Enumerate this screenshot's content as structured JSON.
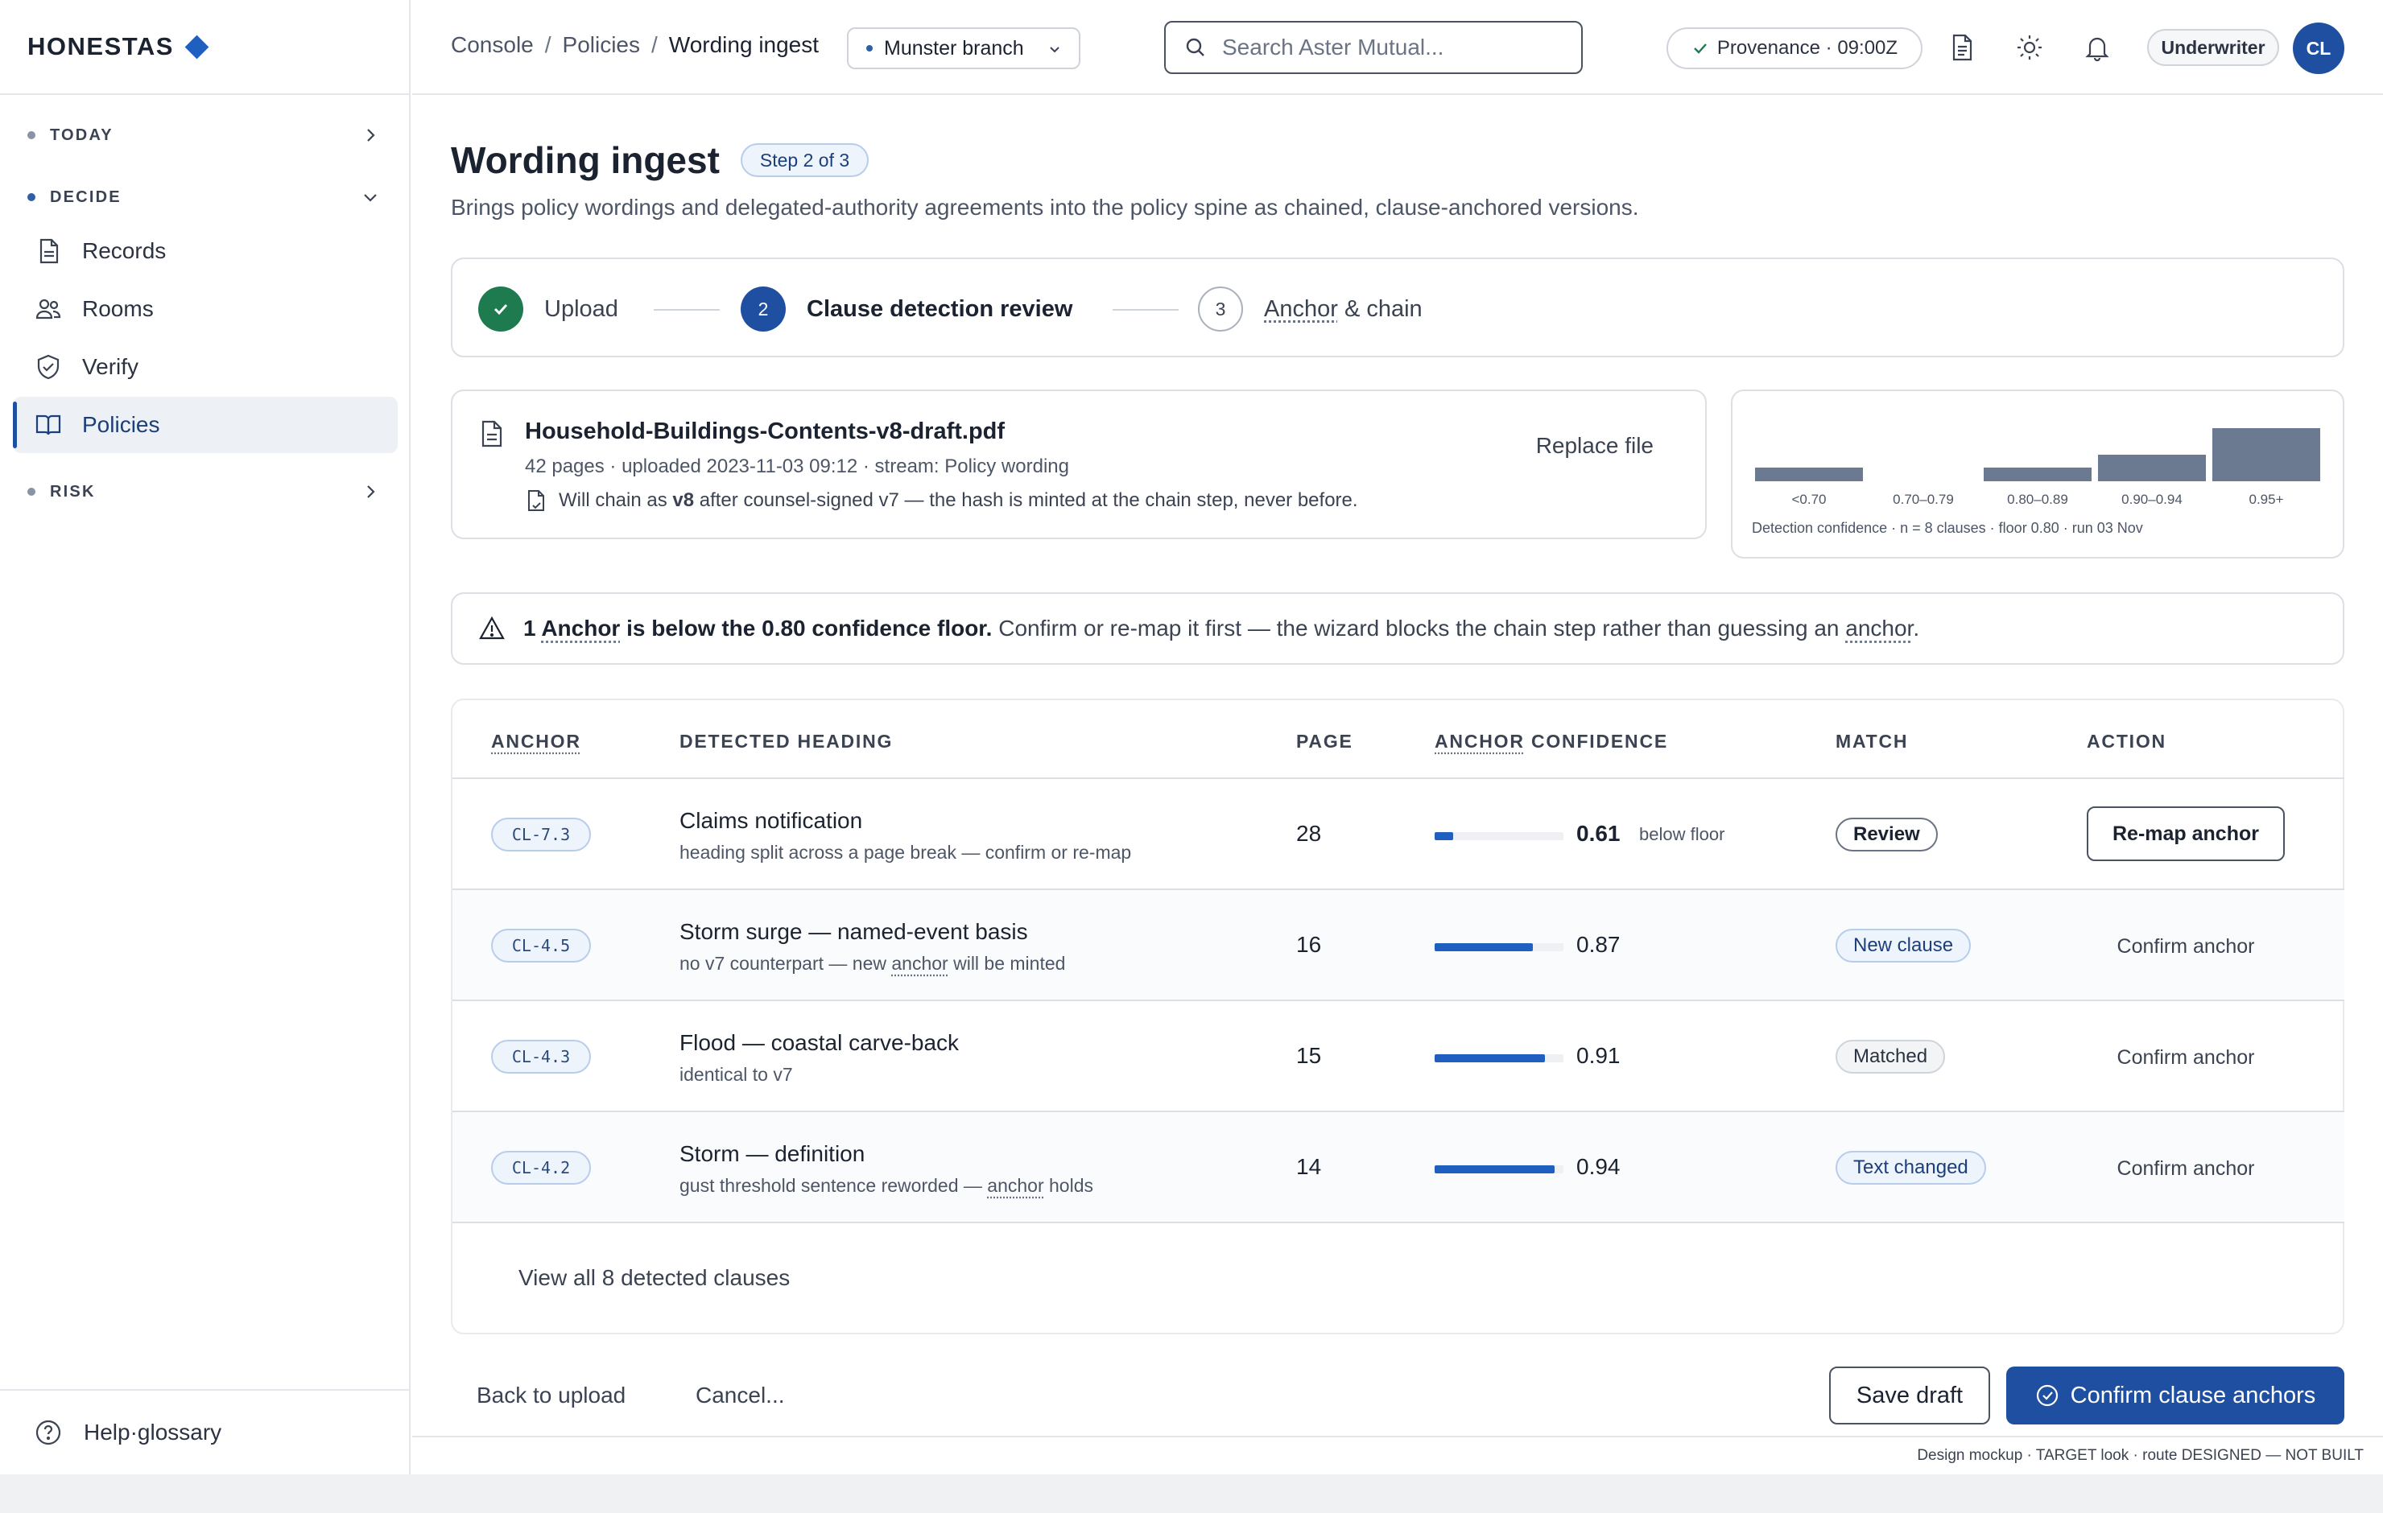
{
  "sidebar": {
    "brand": "HONESTAS",
    "groups": {
      "today": "TODAY",
      "decide": "DECIDE",
      "risk": "RISK"
    },
    "items": [
      {
        "label": "Records",
        "icon": "document-icon"
      },
      {
        "label": "Rooms",
        "icon": "people-icon"
      },
      {
        "label": "Verify",
        "icon": "shield-check-icon"
      },
      {
        "label": "Policies",
        "icon": "book-icon",
        "active": true
      }
    ],
    "help": "Help·glossary"
  },
  "topbar": {
    "breadcrumb": [
      "Console",
      "Policies",
      "Wording ingest"
    ],
    "separator": "/",
    "branch": "Munster branch",
    "search_placeholder": "Search Aster Mutual...",
    "provenance": "Provenance · 09:00Z",
    "role": "Underwriter",
    "avatar": "CL"
  },
  "page": {
    "title": "Wording ingest",
    "step_badge": "Step 2 of 3",
    "subtitle": "Brings policy wordings and delegated-authority agreements into the policy spine as chained, clause-anchored versions."
  },
  "stepper": {
    "steps": [
      {
        "label": "Upload",
        "state": "done"
      },
      {
        "number": "2",
        "label": "Clause detection review",
        "state": "active"
      },
      {
        "number": "3",
        "label_part1": "Anchor",
        "label_part2": " & chain",
        "state": "todo"
      }
    ]
  },
  "file": {
    "name": "Household-Buildings-Contents-v8-draft.pdf",
    "meta": "42 pages · uploaded 2023-11-03 09:12 · stream: Policy wording",
    "chain_pre": "Will chain as ",
    "chain_version": "v8",
    "chain_post": " after counsel-signed v7 — the hash is minted at the chain step, never before.",
    "replace": "Replace file"
  },
  "chart_data": {
    "type": "bar",
    "categories": [
      "<0.70",
      "0.70–0.79",
      "0.80–0.89",
      "0.90–0.94",
      "0.95+"
    ],
    "values": [
      1,
      0,
      1,
      2,
      4
    ],
    "caption": "Detection confidence · n = 8 clauses · floor 0.80 · run 03 Nov",
    "bar_color": "#6c7a91"
  },
  "alert": {
    "count": "1",
    "anchor_word": "Anchor",
    "bold_rest": " is below the 0.80 confidence floor.",
    "text": " Confirm or re-map it first — the wizard blocks the chain step rather than guessing an ",
    "anchor_word2": "anchor",
    "end": "."
  },
  "table": {
    "headers": {
      "anchor": "ANCHOR",
      "heading": "DETECTED HEADING",
      "page": "PAGE",
      "conf_anchor": "ANCHOR",
      "conf_rest": " CONFIDENCE",
      "match": "MATCH",
      "action": "ACTION"
    },
    "rows": [
      {
        "anchor": "CL-7.3",
        "heading": "Claims notification",
        "sub_pre": "heading split across a page break — confirm or re-map",
        "sub_anchor": "",
        "sub_post": "",
        "page": "28",
        "confidence": 0.61,
        "confidence_label": "0.61",
        "note": "below floor",
        "match": "Review",
        "match_style": "review",
        "action": "Re-map anchor",
        "action_style": "button"
      },
      {
        "anchor": "CL-4.5",
        "heading": "Storm surge — named-event basis",
        "sub_pre": "no v7 counterpart — new ",
        "sub_anchor": "anchor",
        "sub_post": " will be minted",
        "page": "16",
        "confidence": 0.87,
        "confidence_label": "0.87",
        "note": "",
        "match": "New clause",
        "match_style": "new",
        "action": "Confirm anchor",
        "action_style": "link"
      },
      {
        "anchor": "CL-4.3",
        "heading": "Flood — coastal carve-back",
        "sub_pre": "identical to v7",
        "sub_anchor": "",
        "sub_post": "",
        "page": "15",
        "confidence": 0.91,
        "confidence_label": "0.91",
        "note": "",
        "match": "Matched",
        "match_style": "matched",
        "action": "Confirm anchor",
        "action_style": "link"
      },
      {
        "anchor": "CL-4.2",
        "heading": "Storm — definition",
        "sub_pre": "gust threshold sentence reworded — ",
        "sub_anchor": "anchor",
        "sub_post": " holds",
        "page": "14",
        "confidence": 0.94,
        "confidence_label": "0.94",
        "note": "",
        "match": "Text changed",
        "match_style": "changed",
        "action": "Confirm anchor",
        "action_style": "link"
      }
    ],
    "view_all": "View all 8 detected clauses"
  },
  "footer": {
    "back": "Back to upload",
    "cancel": "Cancel...",
    "save": "Save draft",
    "confirm": "Confirm clause anchors",
    "note": "Design mockup · TARGET look · route DESIGNED — NOT BUILT"
  },
  "colors": {
    "accent": "#1f4fa0",
    "success": "#1e7a4f",
    "bar": "#1f5fbf"
  }
}
